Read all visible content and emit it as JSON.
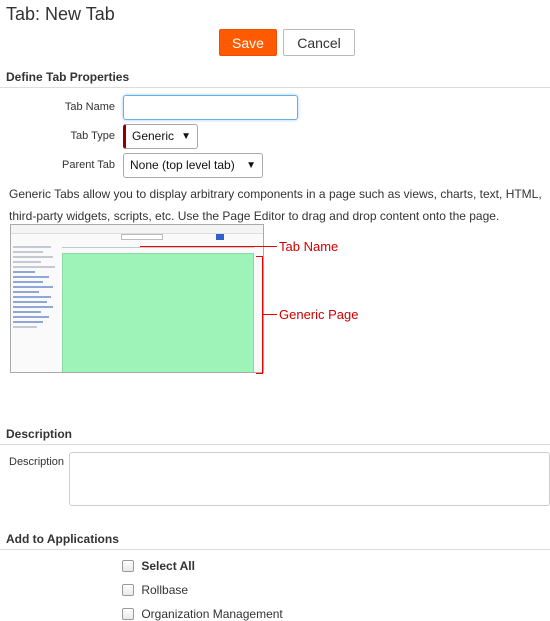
{
  "page": {
    "title": "Tab: New Tab"
  },
  "toolbar": {
    "save_label": "Save",
    "cancel_label": "Cancel"
  },
  "sections": {
    "define": "Define Tab Properties",
    "description": "Description",
    "applications": "Add to Applications"
  },
  "form": {
    "tab_name_label": "Tab Name",
    "tab_name_value": "",
    "tab_type_label": "Tab Type",
    "tab_type_value": "Generic",
    "parent_tab_label": "Parent Tab",
    "parent_tab_value": "None (top level tab)",
    "help_text": "Generic Tabs allow you to display arbitrary components in a page such as views, charts, text, HTML, third-party widgets, scripts, etc. Use the Page Editor to drag and drop content onto the page.",
    "description_label": "Description"
  },
  "illustration": {
    "callout_tab_name": "Tab Name",
    "callout_generic_page": "Generic Page"
  },
  "applications": [
    {
      "label": "Select All",
      "checked": false,
      "bold": true
    },
    {
      "label": "Rollbase",
      "checked": false,
      "bold": false
    },
    {
      "label": "Organization Management",
      "checked": false,
      "bold": false
    }
  ],
  "icons": {
    "dropdown": "chevron-down-icon"
  }
}
